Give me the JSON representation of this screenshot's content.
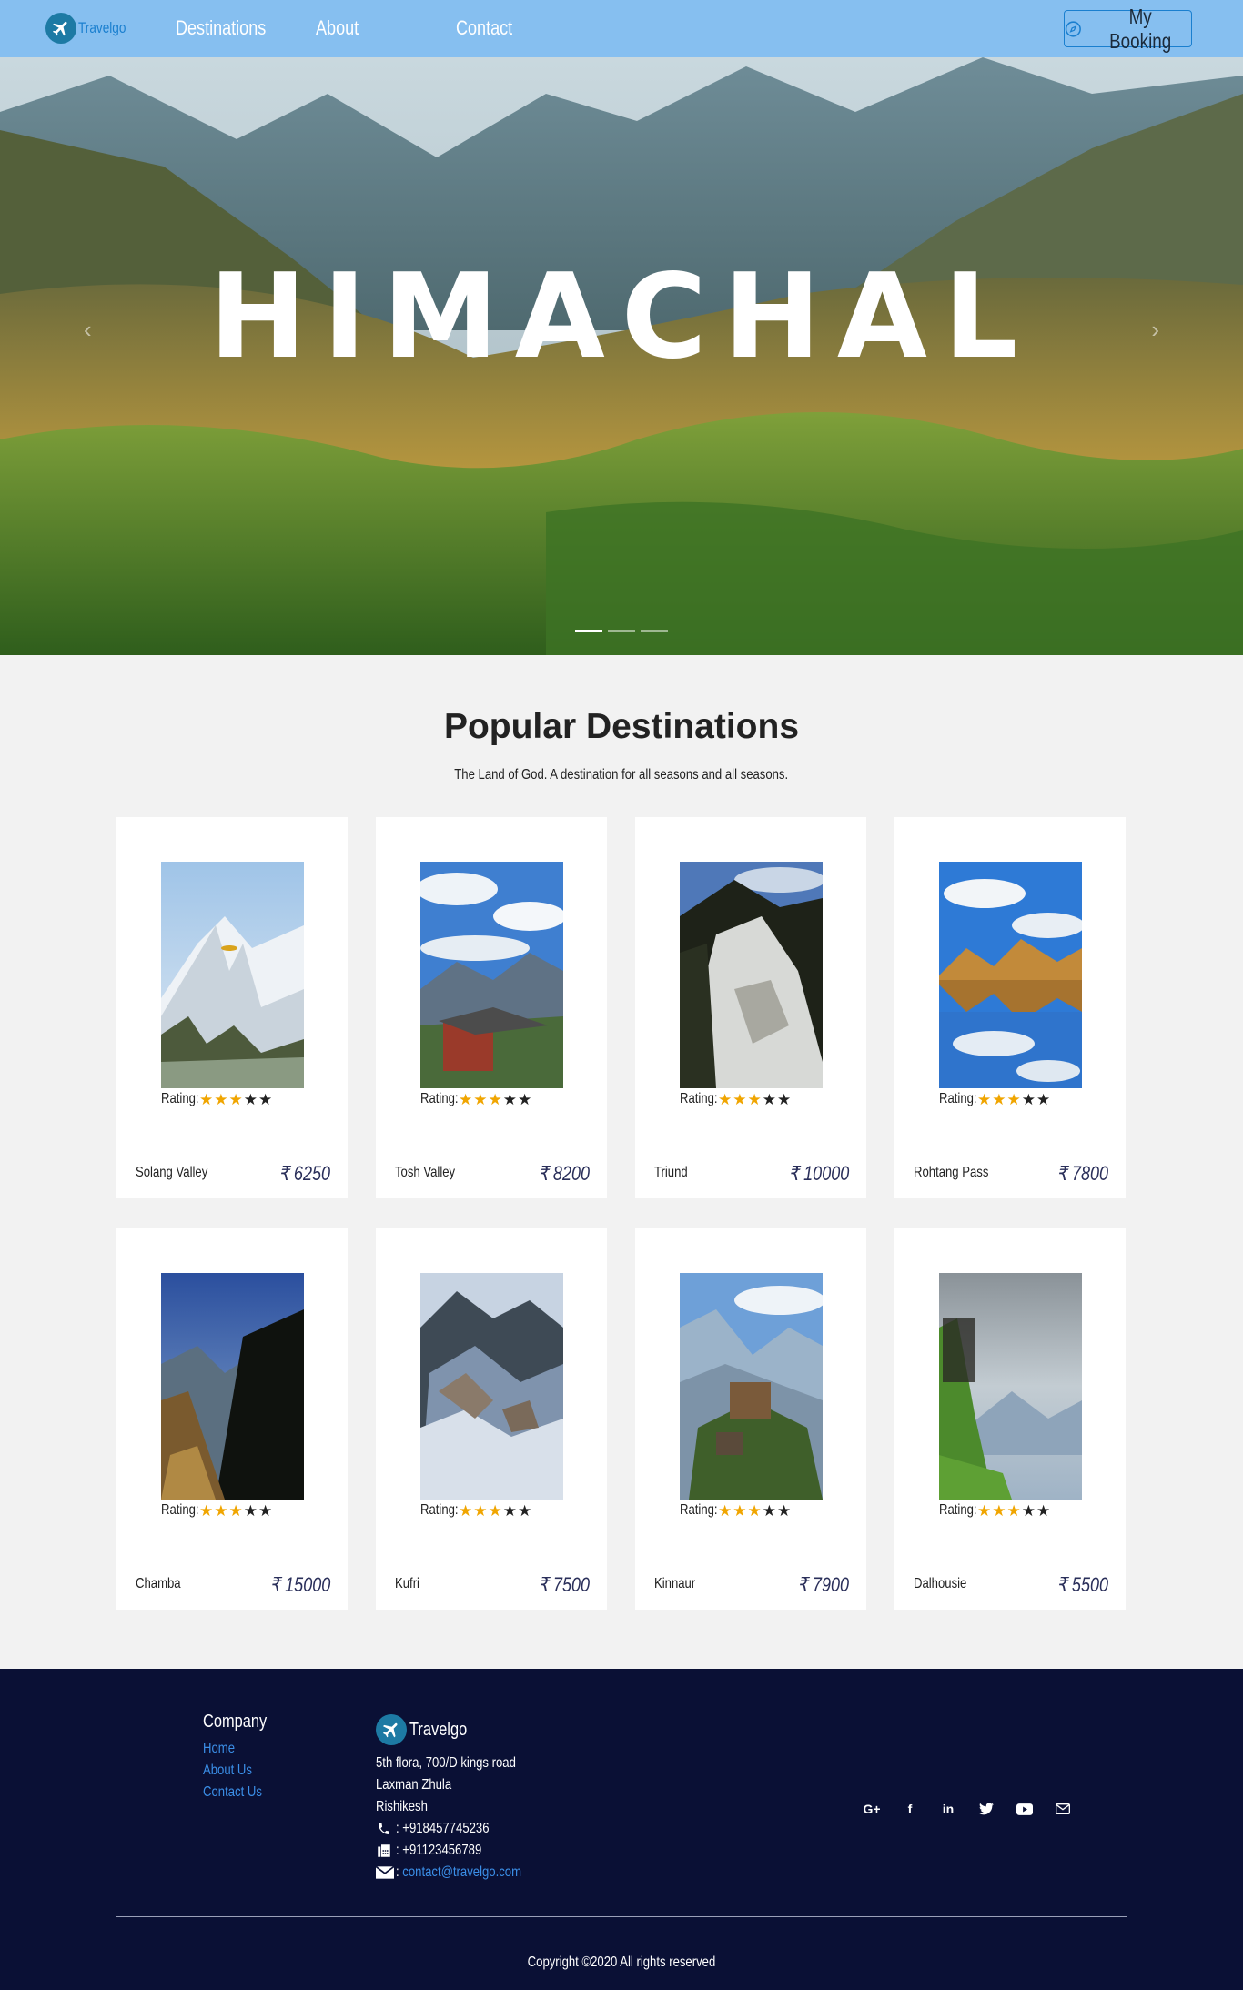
{
  "brand": {
    "name": "Travelgo"
  },
  "nav": {
    "links": [
      "Destinations",
      "About",
      "Contact"
    ],
    "booking_label": "My Booking"
  },
  "hero": {
    "title": "HIMACHAL",
    "prev": "‹",
    "next": "›"
  },
  "section": {
    "title_light": "Popular ",
    "title_bold": "Destinations",
    "subtitle": "The Land of God. A destination for all seasons and all seasons."
  },
  "rating_label": "Rating:",
  "destinations": [
    {
      "name": "Solang Valley",
      "price": "₹ 6250",
      "stars": 3
    },
    {
      "name": "Tosh Valley",
      "price": "₹ 8200",
      "stars": 3
    },
    {
      "name": "Triund",
      "price": "₹ 10000",
      "stars": 3
    },
    {
      "name": "Rohtang Pass",
      "price": "₹ 7800",
      "stars": 3
    },
    {
      "name": "Chamba",
      "price": "₹ 15000",
      "stars": 3
    },
    {
      "name": "Kufri",
      "price": "₹ 7500",
      "stars": 3
    },
    {
      "name": "Kinnaur",
      "price": "₹ 7900",
      "stars": 3
    },
    {
      "name": "Dalhousie",
      "price": "₹ 5500",
      "stars": 3
    }
  ],
  "footer": {
    "company_heading": "Company",
    "company_links": [
      "Home",
      "About Us",
      "Contact Us"
    ],
    "brand_name": "Travelgo",
    "address": [
      "5th flora, 700/D kings road",
      "Laxman Zhula",
      "Rishikesh"
    ],
    "phone": ": +918457745236",
    "fax": ": +91123456789",
    "email_prefix": ": ",
    "email": "contact@travelgo.com",
    "social": [
      "G+",
      "f",
      "in",
      "twitter",
      "youtube",
      "mail"
    ],
    "copyright": "Copyright ©2020 All rights reserved"
  },
  "colors": {
    "navbar": "#86bff0",
    "accent": "#1a7fcf",
    "footer": "#0a1035",
    "star": "#f0a500"
  }
}
